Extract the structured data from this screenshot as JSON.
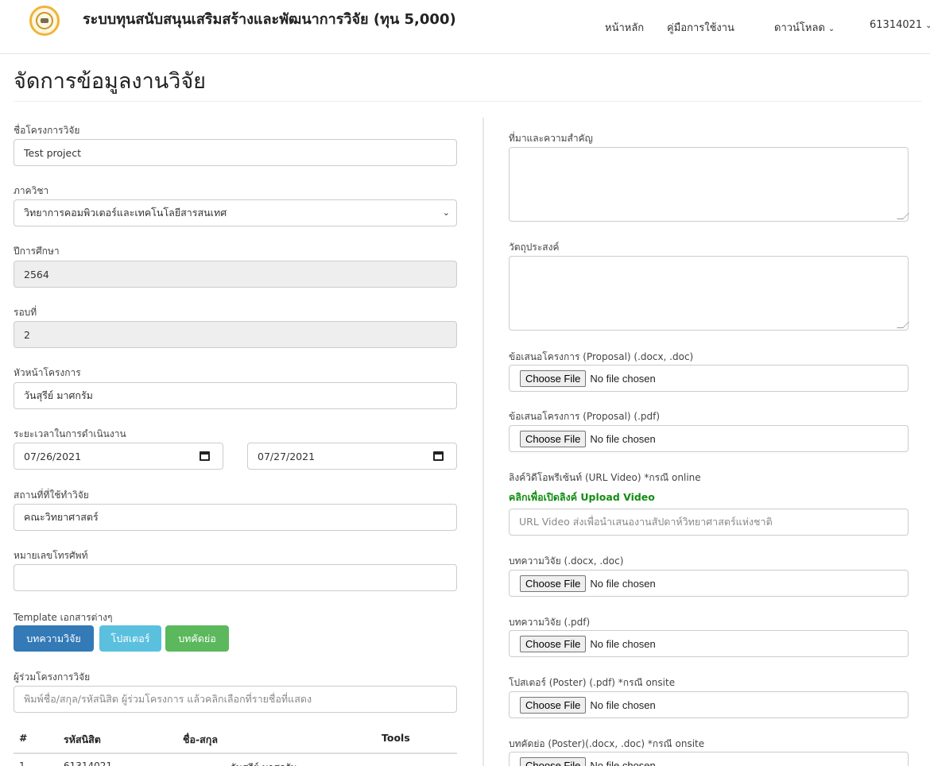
{
  "app": {
    "title": "ระบบทุนสนับสนุนเสริมสร้างและพัฒนาการวิจัย (ทุน 5,000)"
  },
  "nav": {
    "home": "หน้าหลัก",
    "manual": "คู่มือการใช้งาน",
    "download": "ดาวน์โหลด",
    "user": "61314021"
  },
  "page": {
    "title": "จัดการข้อมูลงานวิจัย"
  },
  "left": {
    "project_name": {
      "label": "ชื่อโครงการวิจัย",
      "value": "Test project"
    },
    "department": {
      "label": "ภาควิชา",
      "value": "วิทยาการคอมพิวเตอร์และเทคโนโลยีสารสนเทศ"
    },
    "academic_year": {
      "label": "ปีการศึกษา",
      "value": "2564"
    },
    "round": {
      "label": "รอบที่",
      "value": "2"
    },
    "leader": {
      "label": "หัวหน้าโครงการ",
      "value": "วันสุรีย์ มาศกรัม"
    },
    "duration": {
      "label": "ระยะเวลาในการดำเนินงาน",
      "start": "07/26/2021",
      "end": "07/27/2021"
    },
    "location": {
      "label": "สถานที่ที่ใช้ทำวิจัย",
      "value": "คณะวิทยาศาสตร์"
    },
    "phone": {
      "label": "หมายเลขโทรศัพท์",
      "value": ""
    },
    "templates": {
      "label": "Template เอกสารต่างๆ",
      "article": "บทความวิจัย",
      "poster": "โปสเตอร์",
      "abstract": "บทคัดย่อ"
    },
    "co_researchers": {
      "label": "ผู้ร่วมโครงการวิจัย",
      "placeholder": "พิมพ์ชื่อ/สกุล/รหัสนิสิต ผู้ร่วมโครงการ แล้วคลิกเลือกที่รายชื่อที่แสดง"
    },
    "table": {
      "headers": [
        "#",
        "รหัสนิสิต",
        "ชื่อ-สกุล",
        "Tools"
      ],
      "rows": [
        {
          "no": "1",
          "id": "61314021",
          "name": "วันสุรีย์ มาศกรัม"
        }
      ]
    }
  },
  "right": {
    "background": {
      "label": "ที่มาและความสำคัญ"
    },
    "objective": {
      "label": "วัตถุประสงค์"
    },
    "file_button": "Choose File",
    "file_status": "No file chosen",
    "proposal_docx": {
      "label": "ข้อเสนอโครงการ (Proposal) (.docx, .doc)"
    },
    "proposal_pdf": {
      "label": "ข้อเสนอโครงการ (Proposal) (.pdf)"
    },
    "video": {
      "label": "ลิงค์วิดีโอพรีเซ้นท์ (URL Video) *กรณี online",
      "link": "คลิกเพื่อเปิดลิงค์ Upload Video",
      "placeholder": "URL Video ส่งเพื่อนำเสนองานสัปดาห์วิทยาศาสตร์แห่งชาติ"
    },
    "article_docx": {
      "label": "บทความวิจัย (.docx, .doc)"
    },
    "article_pdf": {
      "label": "บทความวิจัย (.pdf)"
    },
    "poster_pdf": {
      "label": "โปสเตอร์ (Poster) (.pdf) *กรณี onsite"
    },
    "abstract_docx": {
      "label": "บทคัดย่อ (Poster)(.docx, .doc) *กรณี onsite"
    }
  },
  "colors": {
    "primary": "#337ab7",
    "info": "#5bc0de",
    "success": "#5cb85c",
    "link_green": "#128d12"
  }
}
